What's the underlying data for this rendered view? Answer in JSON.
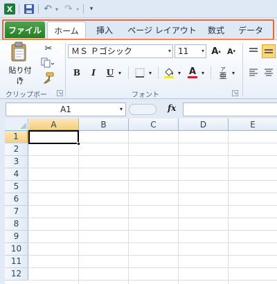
{
  "qat": {
    "logo_letter": "X",
    "undo_glyph": "↶",
    "redo_glyph": "↷",
    "dropdown_glyph": "▾",
    "customize_glyph": "▾"
  },
  "tabs": [
    {
      "label": "ファイル"
    },
    {
      "label": "ホーム"
    },
    {
      "label": "挿入"
    },
    {
      "label": "ページ レイアウト"
    },
    {
      "label": "数式"
    },
    {
      "label": "データ"
    }
  ],
  "clipboard": {
    "paste_label": "貼り付け",
    "group_label": "クリップボード",
    "cut_glyph": "✂"
  },
  "font": {
    "name": "ＭＳ Ｐゴシック",
    "size": "11",
    "grow_label": "A",
    "shrink_label": "A",
    "bold_label": "B",
    "italic_label": "I",
    "underline_label": "U",
    "font_color_label": "A",
    "phonetic_label": "亜",
    "group_label": "フォント",
    "font_color": "#d0202a",
    "highlight_color": "#f5e23a"
  },
  "formula_bar": {
    "name_box": "A1",
    "fx_label": "fx",
    "value": ""
  },
  "grid": {
    "columns": [
      "A",
      "B",
      "C",
      "D",
      "E"
    ],
    "rows": [
      "1",
      "2",
      "3",
      "4",
      "5",
      "6",
      "7",
      "8",
      "9",
      "10",
      "11",
      "12"
    ],
    "active_cell": "A1"
  },
  "colors": {
    "file_tab": "#2f8a2f",
    "tab_highlight": "#e56a2c",
    "ribbon_bg": "#dfe9f5",
    "active_header": "#f6cf7e"
  }
}
